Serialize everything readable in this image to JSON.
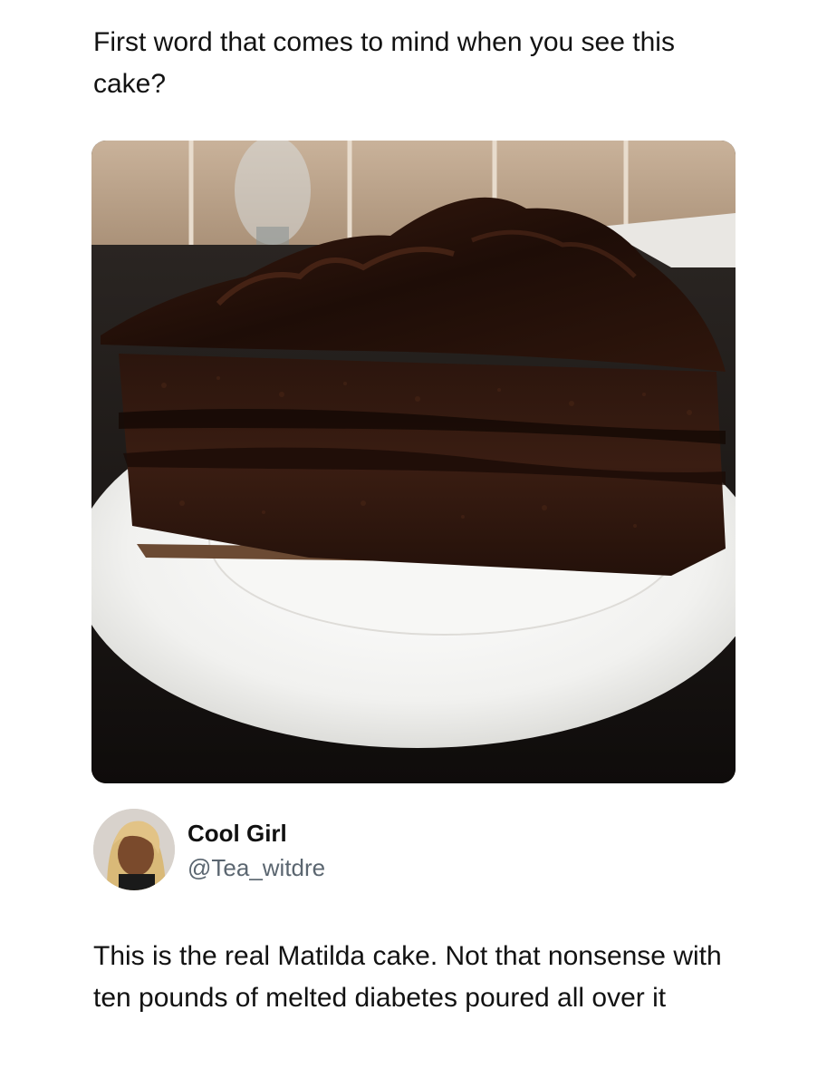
{
  "post": {
    "question_text": "First word that comes to mind when you see this cake?",
    "image_subject": "chocolate-cake-slice-photo"
  },
  "reply": {
    "display_name": "Cool Girl",
    "handle": "@Tea_witdre",
    "text": "This is the real Matilda cake. Not that nonsense with ten pounds of melted diabetes poured all over it"
  },
  "colors": {
    "text": "#121212",
    "handle": "#5b6670",
    "background": "#ffffff"
  }
}
